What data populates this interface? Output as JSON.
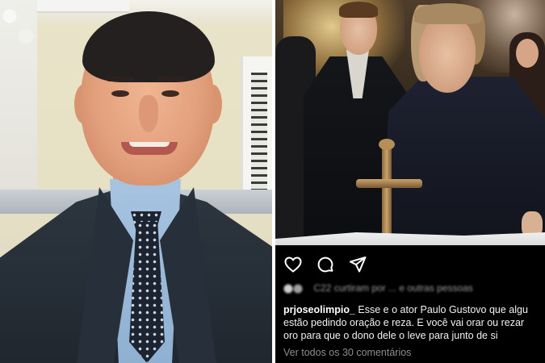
{
  "left_photo": {
    "description_icon": "portrait-photo"
  },
  "right_photo": {
    "icon": "scene-photo"
  },
  "instagram": {
    "icons": [
      "heart-icon",
      "comment-icon",
      "share-icon"
    ],
    "likes_blurred": "C22 curtiram por ... e outras pessoas",
    "caption_user": "prjoseolimpio_",
    "caption_line1": " Esse e o ator Paulo Gustovo que algu",
    "caption_line2": "estão pedindo oração e reza. E você vai orar ou rezar",
    "caption_line3": "oro para que o dono dele o leve para junto de si",
    "comments_link": "Ver todos os 30 comentários"
  }
}
